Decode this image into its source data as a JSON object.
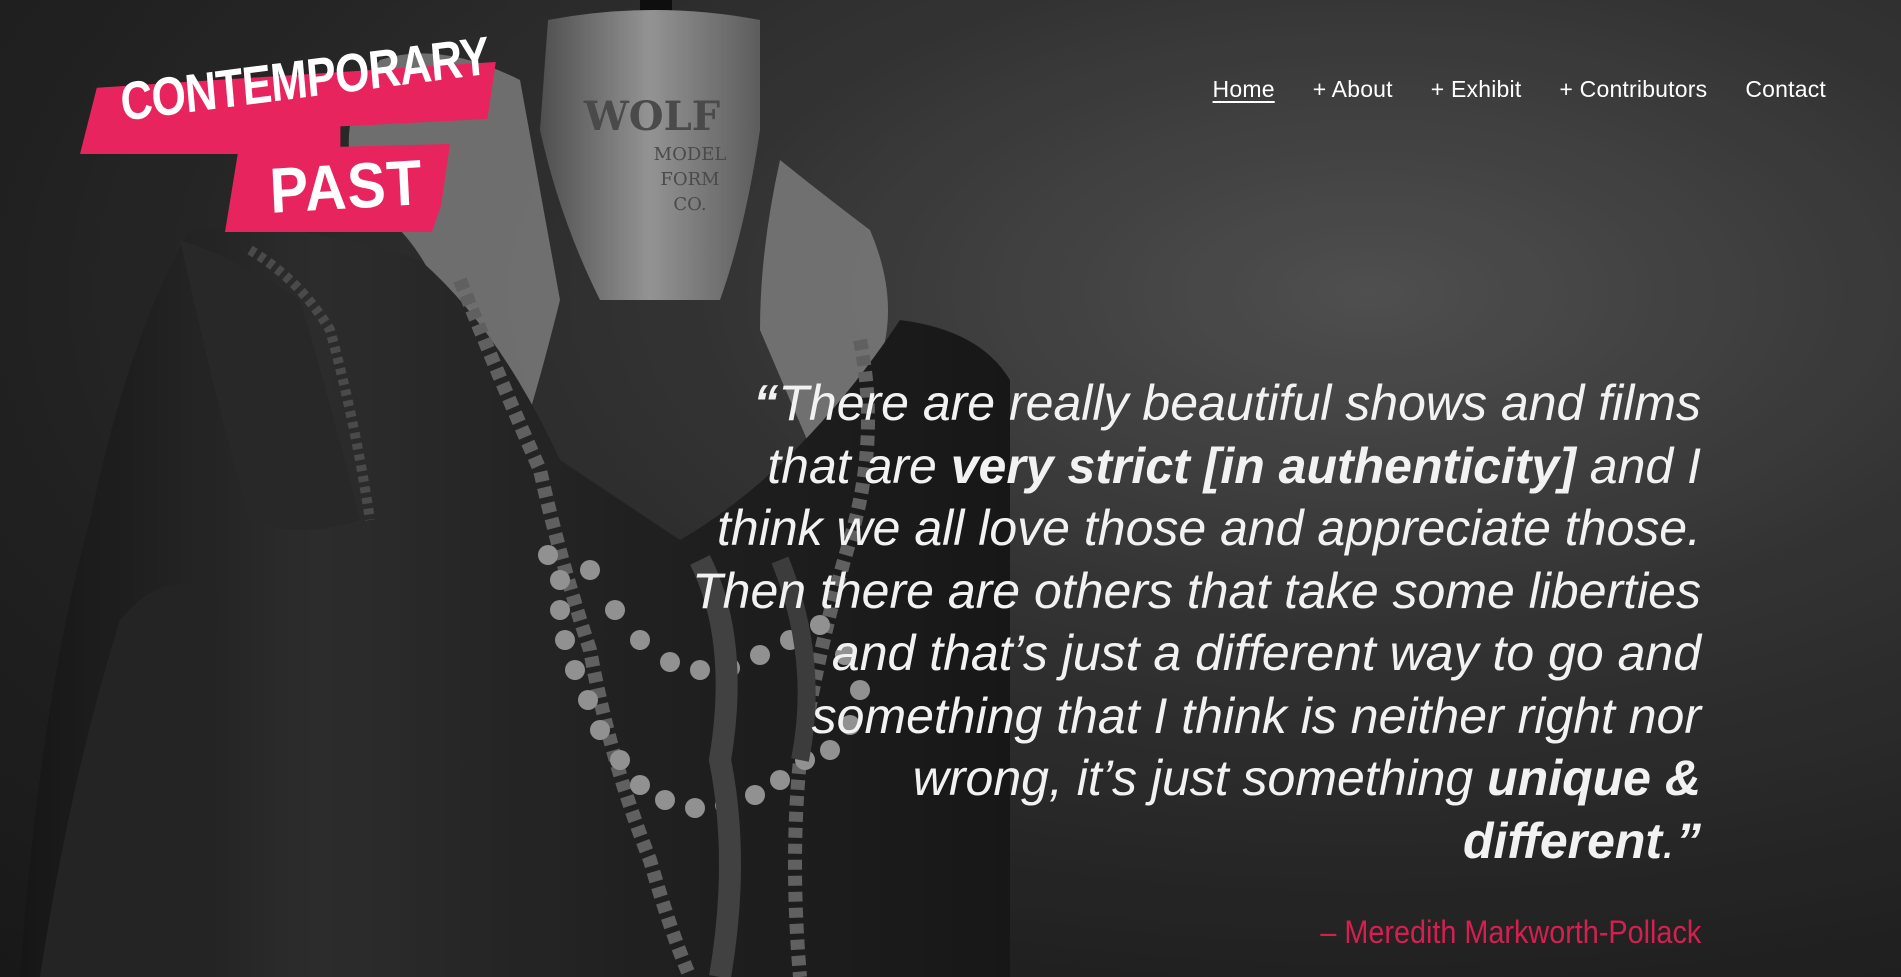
{
  "logo": {
    "line1": "CONTEMPORARY",
    "line2": "PAST",
    "color": "#e8245f"
  },
  "nav": {
    "items": [
      {
        "label": "Home",
        "active": true
      },
      {
        "label": "+ About"
      },
      {
        "label": "+ Exhibit"
      },
      {
        "label": "+ Contributors"
      },
      {
        "label": "Contact"
      }
    ]
  },
  "quote": {
    "open_mark": "“",
    "part1": "There are really beautiful shows and films that are ",
    "emphasis1": "very strict [in authenticity]",
    "part2": " and I think we all love those and appreciate those.  Then there are others that take some liberties and that’s just a different way to go and something that I think is neither right nor wrong, it’s just something ",
    "emphasis2": "unique & different",
    "part3": ".",
    "close_mark": "”"
  },
  "attribution": "– Meredith Markworth-Pollack",
  "hero_image": {
    "subject": "dress-form-garment-icon"
  }
}
